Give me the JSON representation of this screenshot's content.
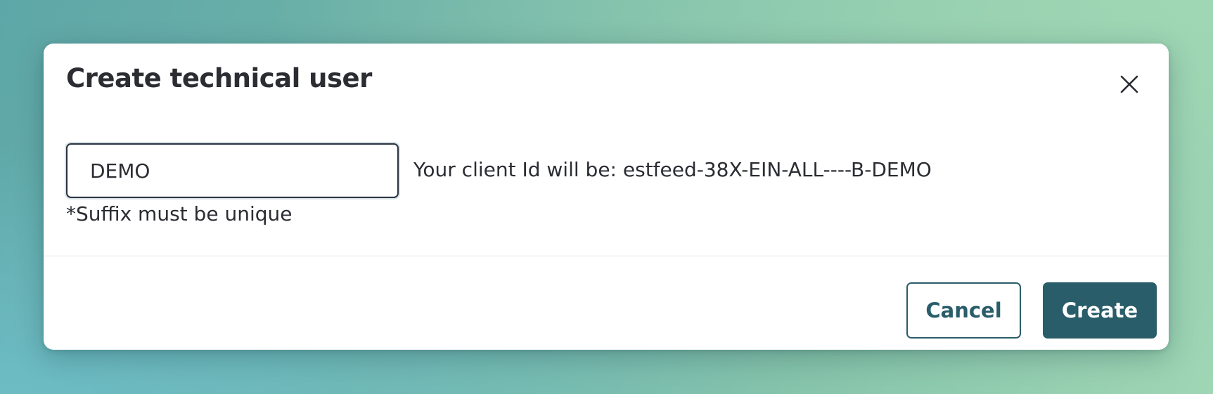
{
  "dialog": {
    "title": "Create technical user",
    "close_icon": "close-icon",
    "suffix_input": {
      "value": "DEMO",
      "placeholder": ""
    },
    "client_id_text": "Your client Id will be: estfeed-38X-EIN-ALL----B-DEMO",
    "suffix_hint": "*Suffix must be unique",
    "cancel_label": "Cancel",
    "create_label": "Create"
  },
  "colors": {
    "primary": "#2a5d6a",
    "text": "#2b2d33",
    "background_start": "#5ea7a8",
    "background_end": "#9fd6b4"
  }
}
